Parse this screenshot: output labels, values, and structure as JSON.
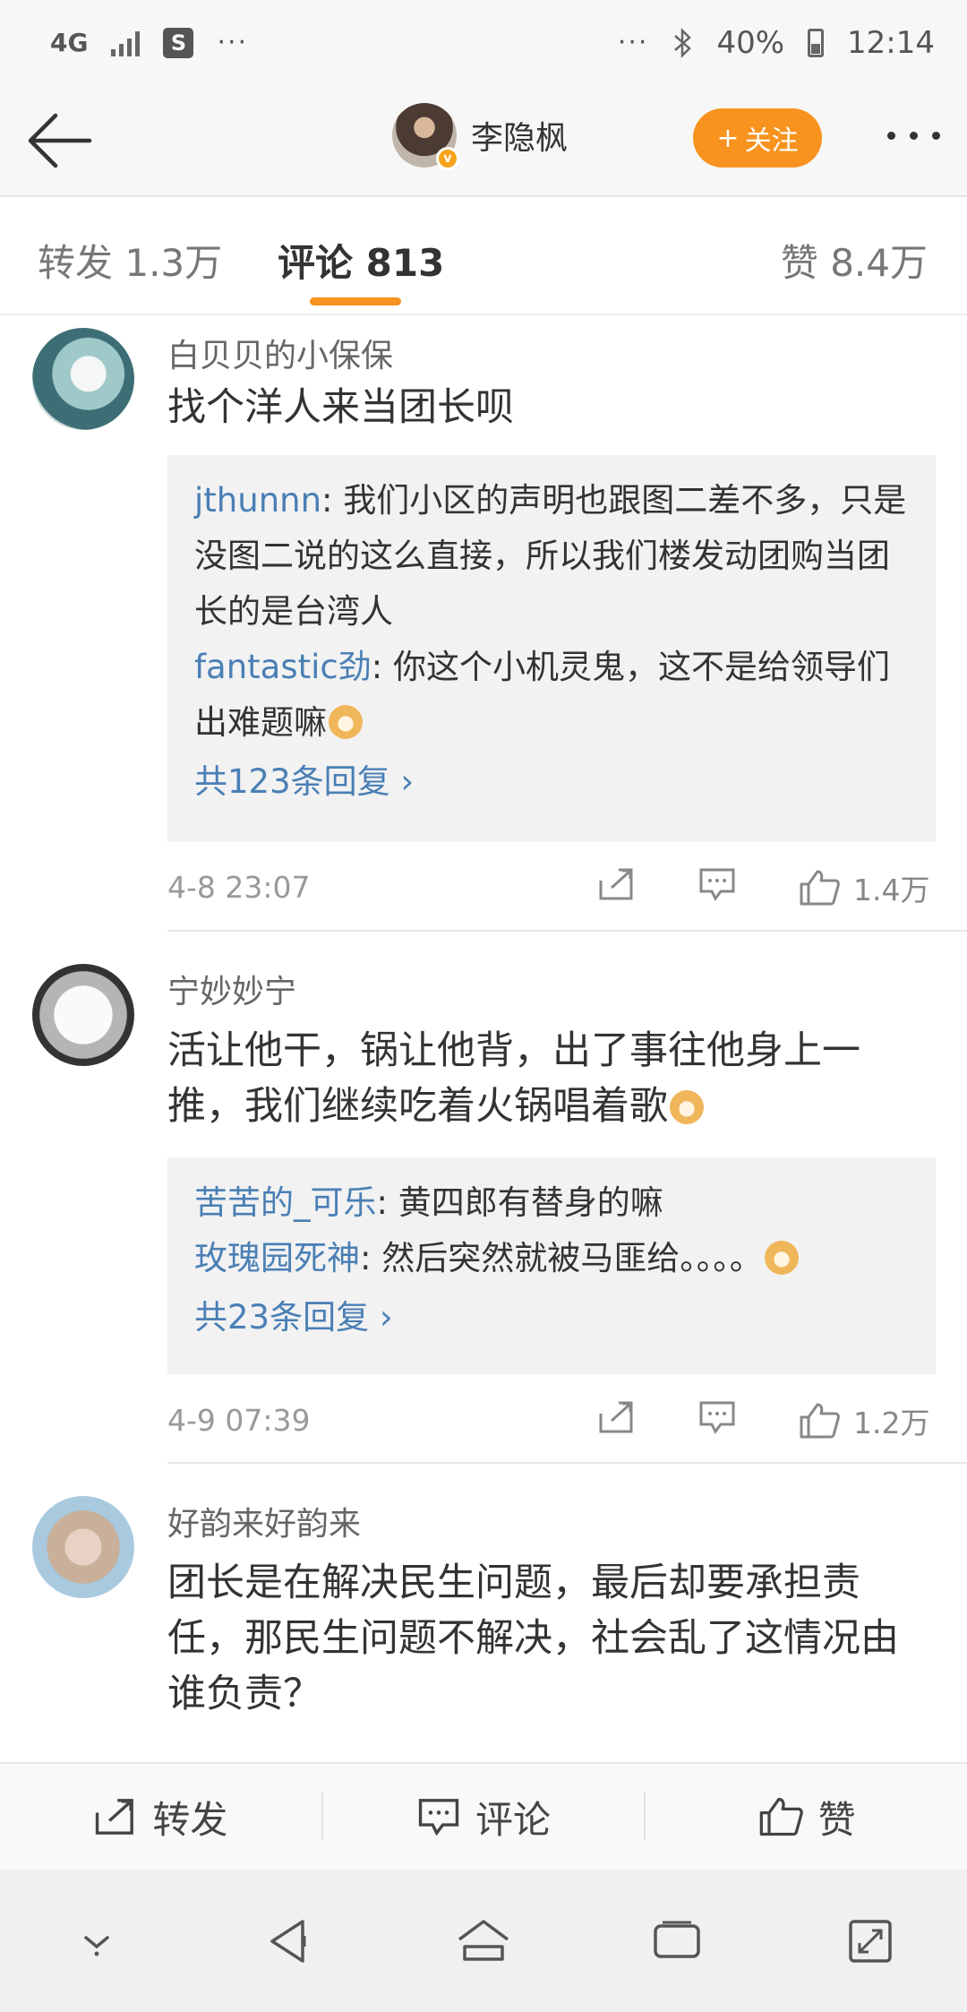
{
  "status_bar": {
    "network": "4G",
    "more": "···",
    "right_more": "···",
    "battery": "40%",
    "time": "12:14",
    "bag_letter": "S"
  },
  "header": {
    "name": "李隐枫",
    "follow_label": "关注"
  },
  "tabs": {
    "repost": "转发 1.3万",
    "comments": "评论 813",
    "likes": "赞 8.4万"
  },
  "comments": [
    {
      "user": "白贝贝的小保保",
      "text": "找个洋人来当团长呗",
      "replies": [
        {
          "user": "jthunnn",
          "text": ": 我们小区的声明也跟图二差不多，只是没图二说的这么直接，所以我们楼发动团购当团长的是台湾人"
        },
        {
          "user": "fantastic劲",
          "text": ": 你这个小机灵鬼，这不是给领导们出难题嘛"
        }
      ],
      "more_replies": "共123条回复 ›",
      "time": "4-8 23:07",
      "likes": "1.4万"
    },
    {
      "user": "宁妙妙宁",
      "text": "活让他干，锅让他背，出了事往他身上一推，我们继续吃着火锅唱着歌",
      "replies": [
        {
          "user": "苦苦的_可乐",
          "text": ": 黄四郎有替身的嘛"
        },
        {
          "user": "玫瑰园死神",
          "text": ": 然后突然就被马匪给。。。。"
        }
      ],
      "more_replies": "共23条回复 ›",
      "time": "4-9 07:39",
      "likes": "1.2万"
    },
    {
      "user": "好韵来好韵来",
      "text": "团长是在解决民生问题，最后却要承担责任，那民生问题不解决，社会乱了这情况由谁负责？"
    }
  ],
  "bottom_bar": {
    "repost": "转发",
    "comment": "评论",
    "like": "赞"
  },
  "colors": {
    "accent": "#f7931e",
    "link": "#4a7fb5"
  }
}
